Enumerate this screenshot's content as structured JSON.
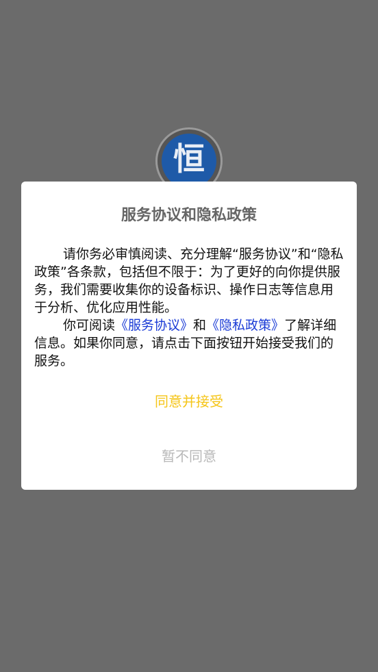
{
  "logo": {
    "glyph": "恒"
  },
  "dialog": {
    "title": "服务协议和隐私政策",
    "paragraph1": "请你务必审慎阅读、充分理解“服务协议”和“隐私政策”各条款，包括但不限于：为了更好的向你提供服务，我们需要收集你的设备标识、操作日志等信息用于分析、优化应用性能。",
    "paragraph2_prefix": "你可阅读",
    "service_link": "《服务协议》",
    "paragraph2_and": "和",
    "privacy_link": "《隐私政策》",
    "paragraph2_suffix": "了解详细信息。如果你同意，请点击下面按钮开始接受我们的服务。",
    "agree_label": "同意并接受",
    "decline_label": "暂不同意"
  },
  "colors": {
    "overlay": "#6b6b6b",
    "link": "#1a3bd6",
    "agree": "#f5c518",
    "decline": "#b8b8b8"
  }
}
